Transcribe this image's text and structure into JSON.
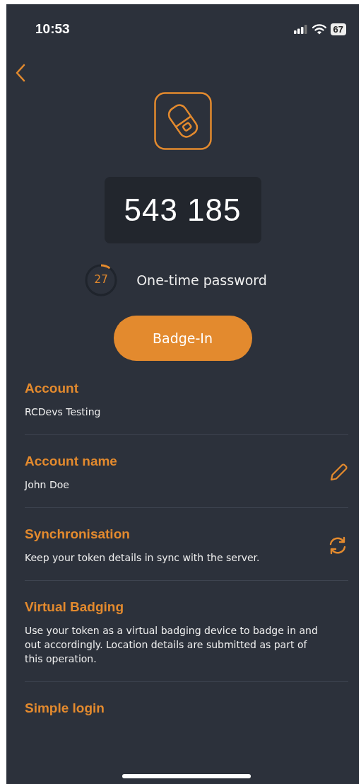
{
  "status_bar": {
    "time": "10:53",
    "battery": "67"
  },
  "otp": {
    "code": "543 185",
    "seconds": "27",
    "level": 0.1,
    "label": "One-time password"
  },
  "badge_button": "Badge-In",
  "sections": [
    {
      "title": "Account",
      "text": "RCDevs Testing",
      "kind": "plain"
    },
    {
      "title": "Account name",
      "text": "John Doe",
      "kind": "edit"
    },
    {
      "title": "Synchronisation",
      "text": "Keep your token details in sync with the server.",
      "kind": "sync"
    },
    {
      "title": "Virtual Badging",
      "text": "Use your token as a virtual badging device to badge in and out accordingly. Location details are submitted as part of this operation.",
      "kind": "plain"
    },
    {
      "title": "Simple login",
      "kind": "plain"
    }
  ]
}
